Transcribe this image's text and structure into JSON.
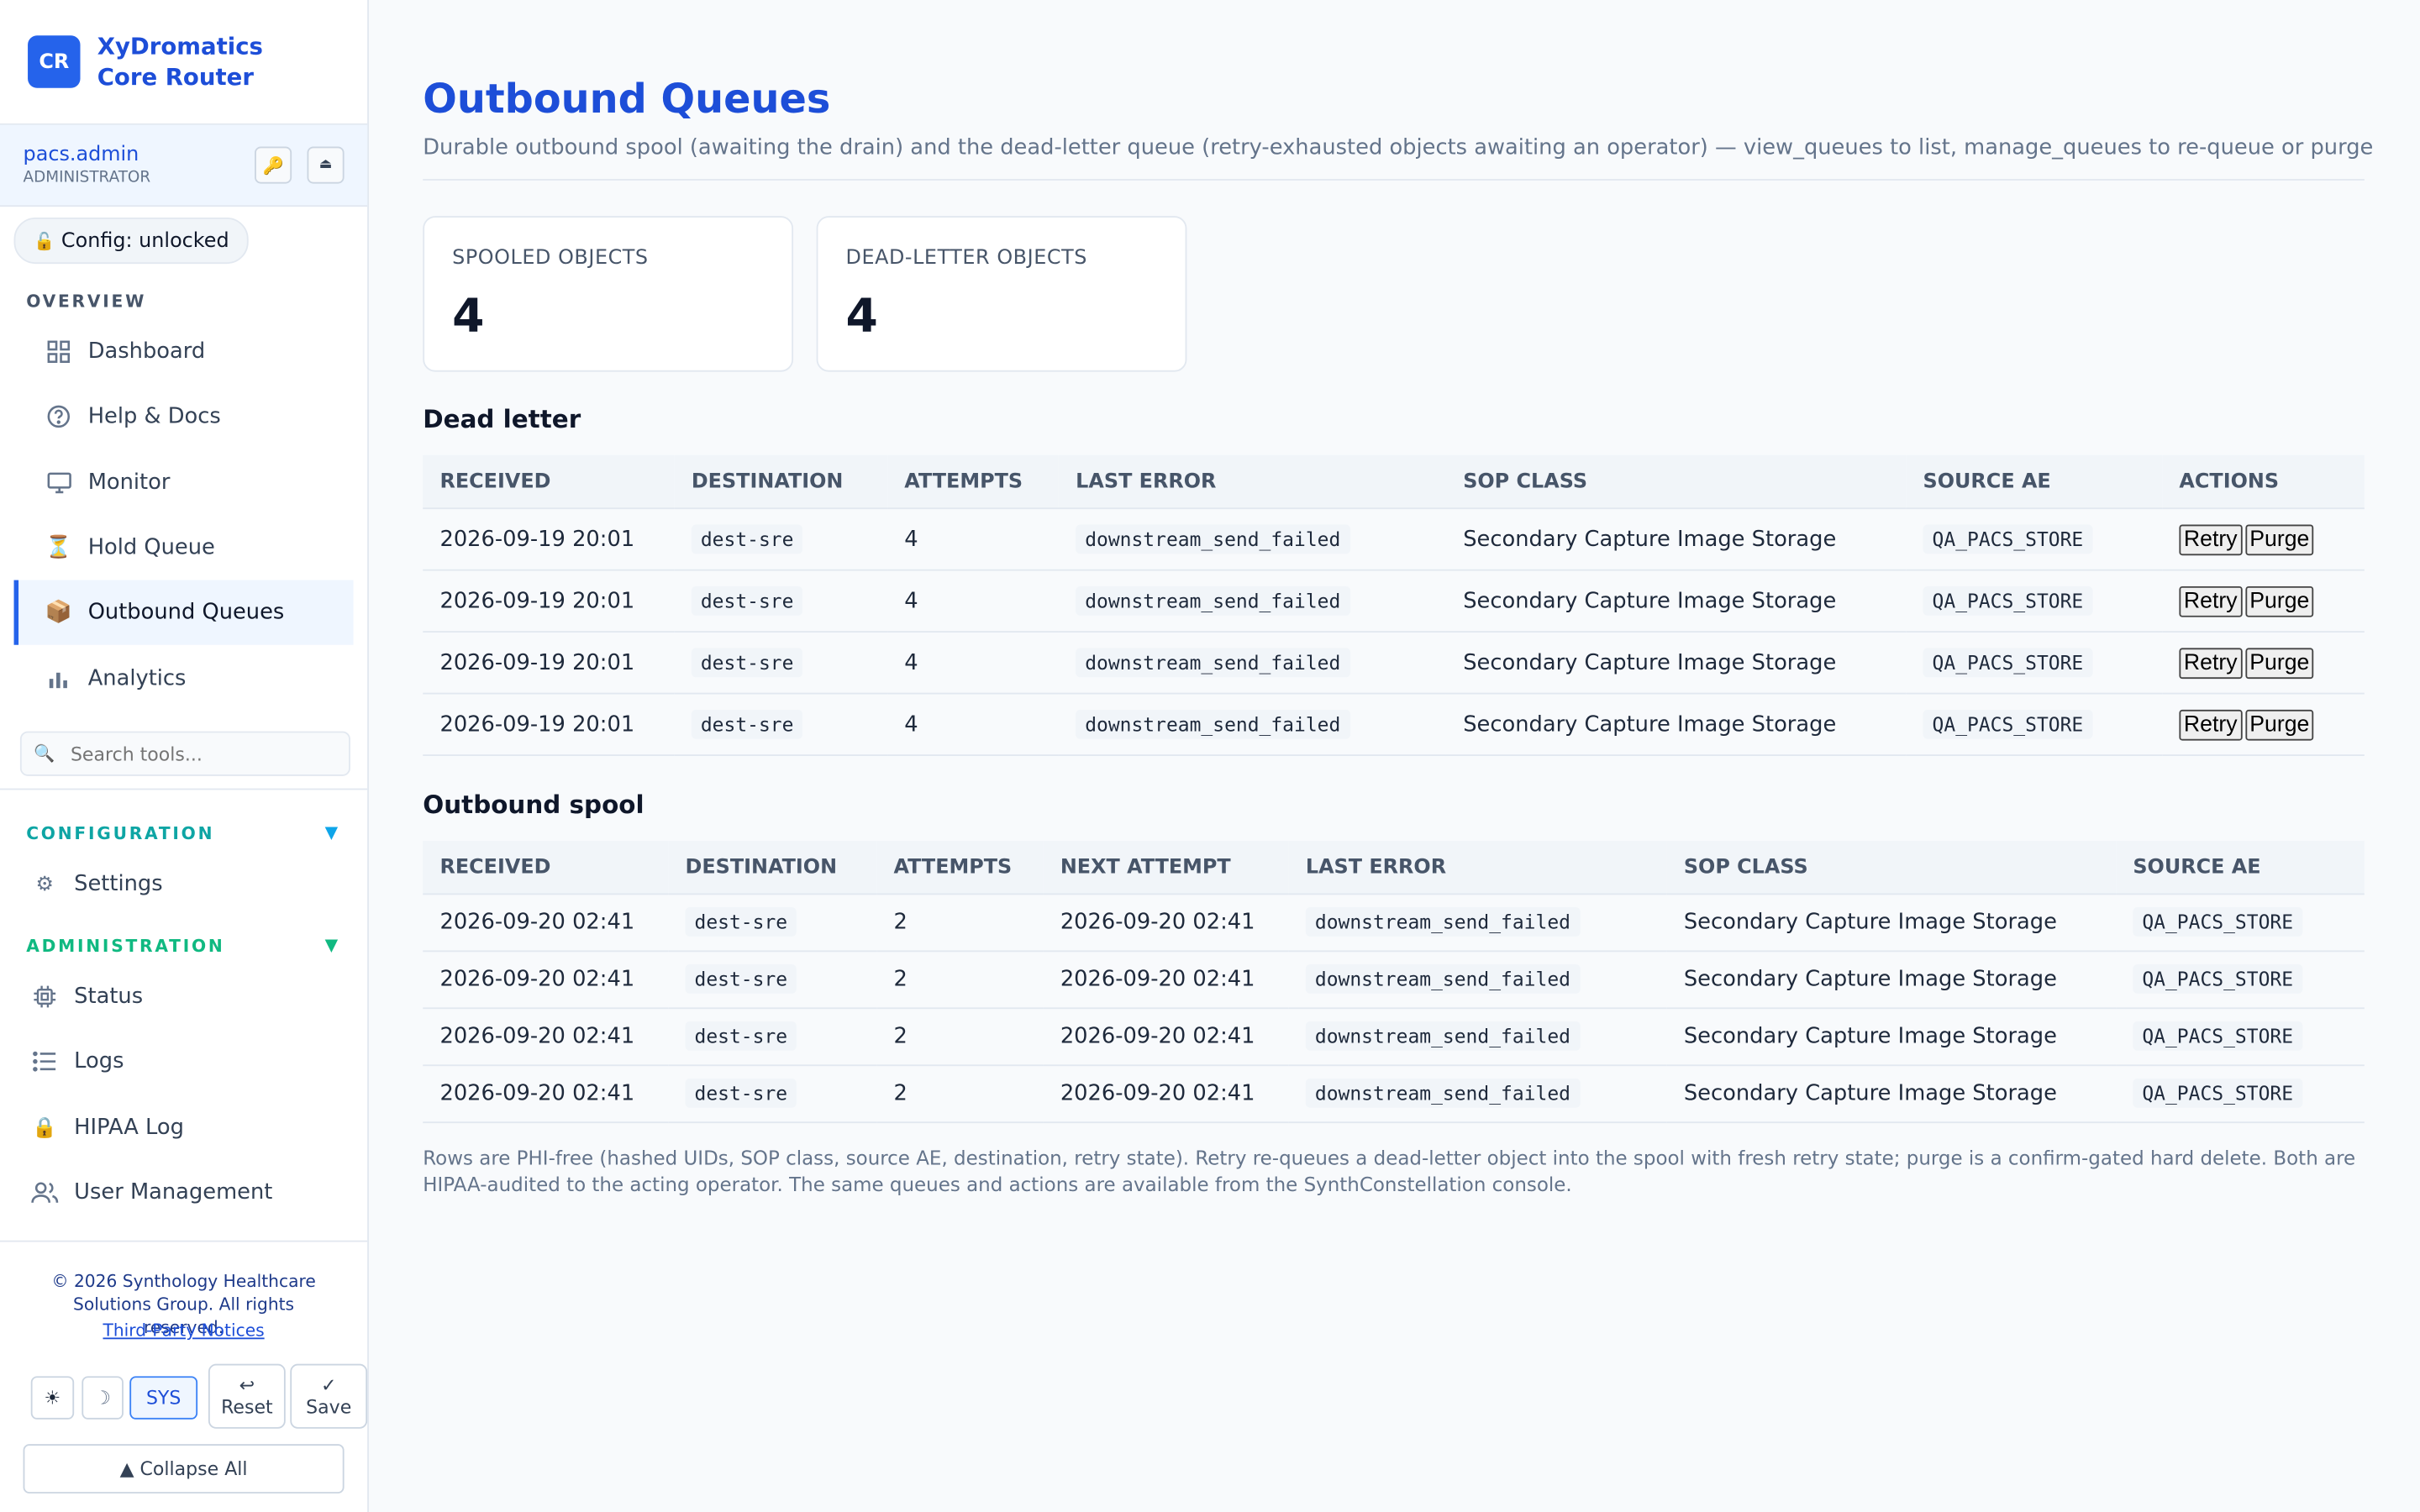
{
  "brand": {
    "badge": "CR",
    "name": "XyDromatics Core Router"
  },
  "user": {
    "name": "pacs.admin",
    "role": "ADMINISTRATOR",
    "key_icon": "key-icon",
    "eject_icon": "eject-icon"
  },
  "config_status": "Config: unlocked",
  "sidebar": {
    "overview_heading": "OVERVIEW",
    "overview_items": [
      {
        "label": "Dashboard",
        "icon": "grid-icon"
      },
      {
        "label": "Help & Docs",
        "icon": "help-circle-icon"
      },
      {
        "label": "Monitor",
        "icon": "monitor-icon"
      },
      {
        "label": "Hold Queue",
        "icon": "hourglass-icon"
      },
      {
        "label": "Outbound Queues",
        "icon": "package-icon",
        "active": true
      },
      {
        "label": "Analytics",
        "icon": "bar-chart-icon"
      }
    ],
    "search_placeholder": "Search tools...",
    "configuration_heading": "CONFIGURATION",
    "configuration_items": [
      {
        "label": "Settings",
        "icon": "gear-icon"
      }
    ],
    "administration_heading": "ADMINISTRATION",
    "administration_items": [
      {
        "label": "Status",
        "icon": "chip-icon"
      },
      {
        "label": "Logs",
        "icon": "list-icon"
      },
      {
        "label": "HIPAA Log",
        "icon": "lock-icon"
      },
      {
        "label": "User Management",
        "icon": "users-icon"
      }
    ],
    "footer_copyright": "© 2026 Synthology Healthcare Solutions Group. All rights reserved.",
    "footer_link": "Third-Party Notices",
    "theme_light": "☀",
    "theme_dark": "☽",
    "theme_sys": "SYS",
    "reset_label": "Reset",
    "save_label": "Save",
    "collapse_label": "▲ Collapse All"
  },
  "page": {
    "title": "Outbound Queues",
    "subtitle": "Durable outbound spool (awaiting the drain) and the dead-letter queue (retry-exhausted objects awaiting an operator) — view_queues to list, manage_queues to re-queue or purge"
  },
  "stats": [
    {
      "label": "SPOOLED OBJECTS",
      "value": "4"
    },
    {
      "label": "DEAD-LETTER OBJECTS",
      "value": "4"
    }
  ],
  "dead_letter": {
    "heading": "Dead letter",
    "columns": [
      "RECEIVED",
      "DESTINATION",
      "ATTEMPTS",
      "LAST ERROR",
      "SOP CLASS",
      "SOURCE AE",
      "ACTIONS"
    ],
    "retry_label": "Retry",
    "purge_label": "Purge",
    "rows": [
      {
        "received": "2026-09-19 20:01",
        "destination": "dest-sre",
        "attempts": "4",
        "last_error": "downstream_send_failed",
        "sop_class": "Secondary Capture Image Storage",
        "source_ae": "QA_PACS_STORE"
      },
      {
        "received": "2026-09-19 20:01",
        "destination": "dest-sre",
        "attempts": "4",
        "last_error": "downstream_send_failed",
        "sop_class": "Secondary Capture Image Storage",
        "source_ae": "QA_PACS_STORE"
      },
      {
        "received": "2026-09-19 20:01",
        "destination": "dest-sre",
        "attempts": "4",
        "last_error": "downstream_send_failed",
        "sop_class": "Secondary Capture Image Storage",
        "source_ae": "QA_PACS_STORE"
      },
      {
        "received": "2026-09-19 20:01",
        "destination": "dest-sre",
        "attempts": "4",
        "last_error": "downstream_send_failed",
        "sop_class": "Secondary Capture Image Storage",
        "source_ae": "QA_PACS_STORE"
      }
    ]
  },
  "spool": {
    "heading": "Outbound spool",
    "columns": [
      "RECEIVED",
      "DESTINATION",
      "ATTEMPTS",
      "NEXT ATTEMPT",
      "LAST ERROR",
      "SOP CLASS",
      "SOURCE AE"
    ],
    "rows": [
      {
        "received": "2026-09-20 02:41",
        "destination": "dest-sre",
        "attempts": "2",
        "next_attempt": "2026-09-20 02:41",
        "last_error": "downstream_send_failed",
        "sop_class": "Secondary Capture Image Storage",
        "source_ae": "QA_PACS_STORE"
      },
      {
        "received": "2026-09-20 02:41",
        "destination": "dest-sre",
        "attempts": "2",
        "next_attempt": "2026-09-20 02:41",
        "last_error": "downstream_send_failed",
        "sop_class": "Secondary Capture Image Storage",
        "source_ae": "QA_PACS_STORE"
      },
      {
        "received": "2026-09-20 02:41",
        "destination": "dest-sre",
        "attempts": "2",
        "next_attempt": "2026-09-20 02:41",
        "last_error": "downstream_send_failed",
        "sop_class": "Secondary Capture Image Storage",
        "source_ae": "QA_PACS_STORE"
      },
      {
        "received": "2026-09-20 02:41",
        "destination": "dest-sre",
        "attempts": "2",
        "next_attempt": "2026-09-20 02:41",
        "last_error": "downstream_send_failed",
        "sop_class": "Secondary Capture Image Storage",
        "source_ae": "QA_PACS_STORE"
      }
    ]
  },
  "footnote": "Rows are PHI-free (hashed UIDs, SOP class, source AE, destination, retry state). Retry re-queues a dead-letter object into the spool with fresh retry state; purge is a confirm-gated hard delete. Both are HIPAA-audited to the acting operator. The same queues and actions are available from the SynthConstellation console."
}
